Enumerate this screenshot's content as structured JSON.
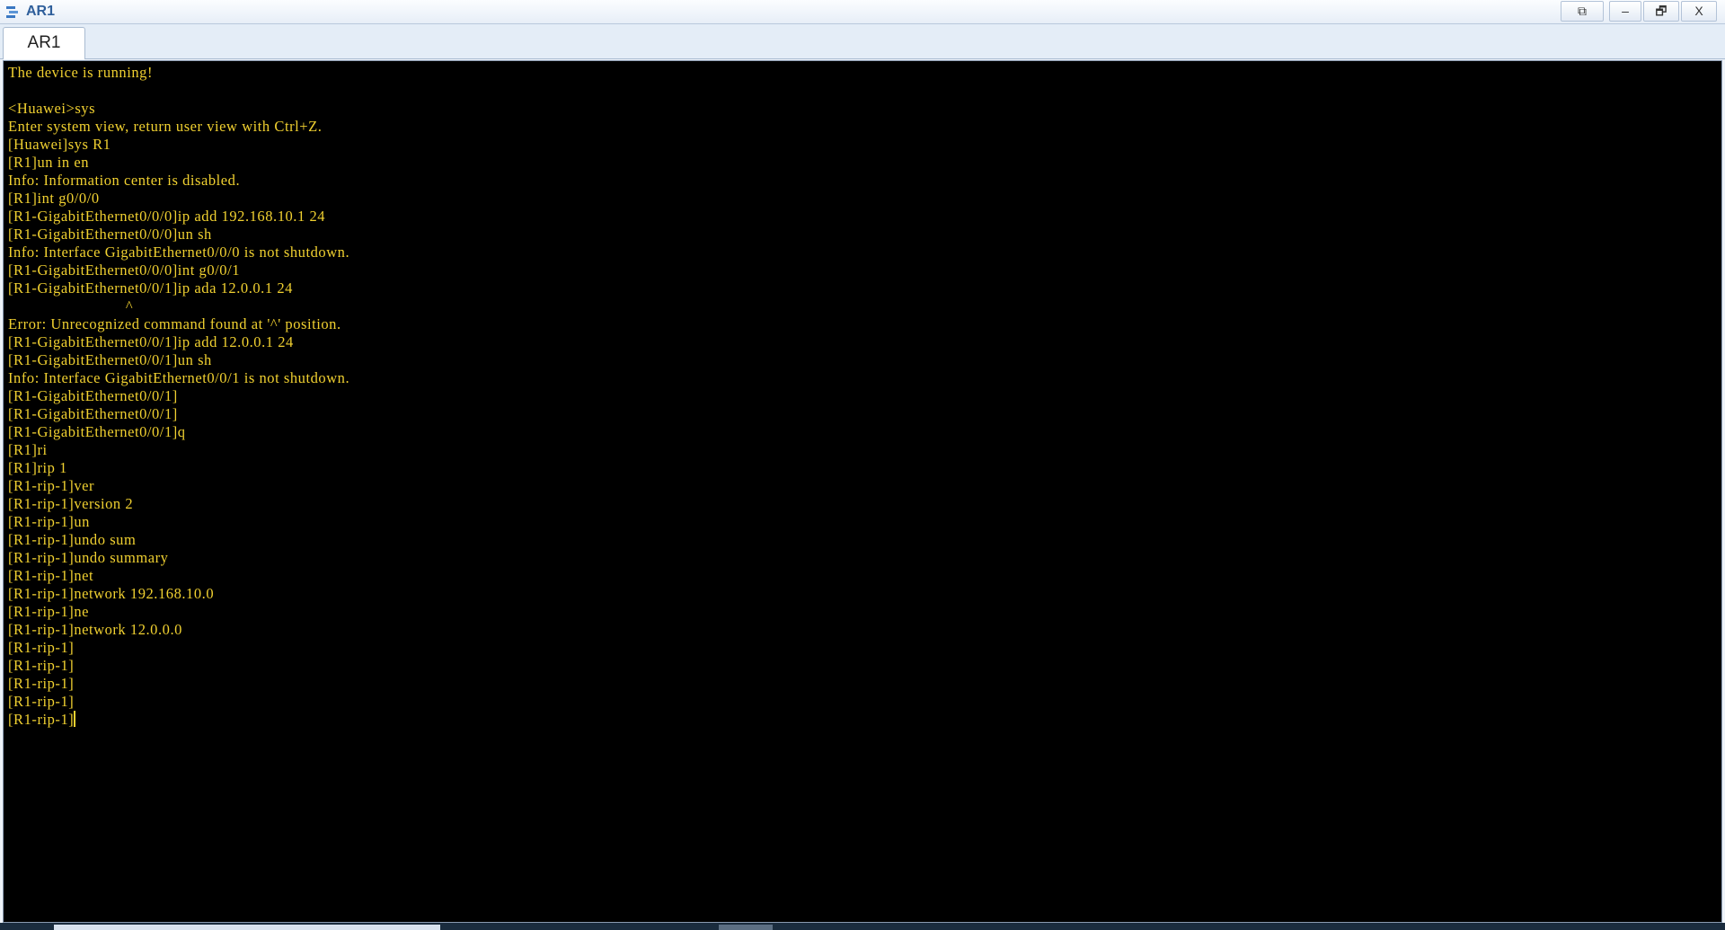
{
  "window": {
    "title": "AR1",
    "controls": {
      "restore_window": "⧉",
      "minimize": "–",
      "maximize": "🗗",
      "close": "X"
    }
  },
  "tabs": [
    {
      "label": "AR1",
      "active": true
    }
  ],
  "terminal": {
    "text_color": "#f0d030",
    "background": "#000000",
    "lines": [
      "The device is running!",
      "",
      "<Huawei>sys",
      "Enter system view, return user view with Ctrl+Z.",
      "[Huawei]sys R1",
      "[R1]un in en",
      "Info: Information center is disabled.",
      "[R1]int g0/0/0",
      "[R1-GigabitEthernet0/0/0]ip add 192.168.10.1 24",
      "[R1-GigabitEthernet0/0/0]un sh",
      "Info: Interface GigabitEthernet0/0/0 is not shutdown.",
      "[R1-GigabitEthernet0/0/0]int g0/0/1",
      "[R1-GigabitEthernet0/0/1]ip ada 12.0.0.1 24",
      "                            ^",
      "Error: Unrecognized command found at '^' position.",
      "[R1-GigabitEthernet0/0/1]ip add 12.0.0.1 24",
      "[R1-GigabitEthernet0/0/1]un sh",
      "Info: Interface GigabitEthernet0/0/1 is not shutdown.",
      "[R1-GigabitEthernet0/0/1]",
      "[R1-GigabitEthernet0/0/1]",
      "[R1-GigabitEthernet0/0/1]q",
      "[R1]ri",
      "[R1]rip 1",
      "[R1-rip-1]ver",
      "[R1-rip-1]version 2",
      "[R1-rip-1]un",
      "[R1-rip-1]undo sum",
      "[R1-rip-1]undo summary",
      "[R1-rip-1]net",
      "[R1-rip-1]network 192.168.10.0",
      "[R1-rip-1]ne",
      "[R1-rip-1]network 12.0.0.0",
      "[R1-rip-1]",
      "[R1-rip-1]",
      "[R1-rip-1]",
      "[R1-rip-1]",
      "[R1-rip-1]"
    ]
  }
}
